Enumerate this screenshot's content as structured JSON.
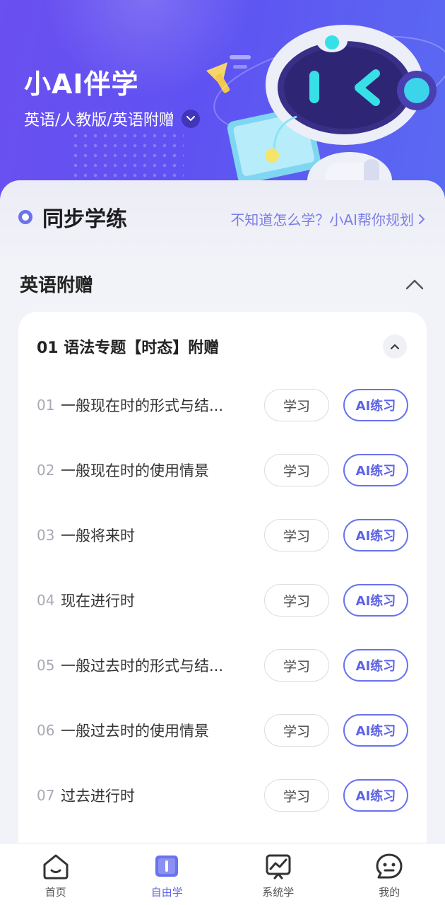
{
  "header": {
    "app_title": "小AI伴学",
    "textbook": "英语/人教版/英语附赠"
  },
  "sync": {
    "title": "同步学练",
    "plan_link": "不知道怎么学？小AI帮你规划"
  },
  "section": {
    "title": "英语附赠"
  },
  "unit": {
    "title": "01 语法专题【时态】附赠",
    "lessons": [
      {
        "num": "01",
        "name": "一般现在时的形式与结...",
        "study": "学习",
        "ai": "AI练习"
      },
      {
        "num": "02",
        "name": "一般现在时的使用情景",
        "study": "学习",
        "ai": "AI练习"
      },
      {
        "num": "03",
        "name": "一般将来时",
        "study": "学习",
        "ai": "AI练习"
      },
      {
        "num": "04",
        "name": "现在进行时",
        "study": "学习",
        "ai": "AI练习"
      },
      {
        "num": "05",
        "name": "一般过去时的形式与结...",
        "study": "学习",
        "ai": "AI练习"
      },
      {
        "num": "06",
        "name": "一般过去时的使用情景",
        "study": "学习",
        "ai": "AI练习"
      },
      {
        "num": "07",
        "name": "过去进行时",
        "study": "学习",
        "ai": "AI练习"
      }
    ]
  },
  "nav": {
    "items": [
      {
        "label": "首页",
        "icon": "home-icon"
      },
      {
        "label": "自由学",
        "icon": "book-icon"
      },
      {
        "label": "系统学",
        "icon": "chart-icon"
      },
      {
        "label": "我的",
        "icon": "profile-chat-icon"
      }
    ],
    "active": "自由学"
  },
  "colors": {
    "accent": "#6a72ee",
    "header_start": "#6b4ff0",
    "header_end": "#5a6af2"
  }
}
